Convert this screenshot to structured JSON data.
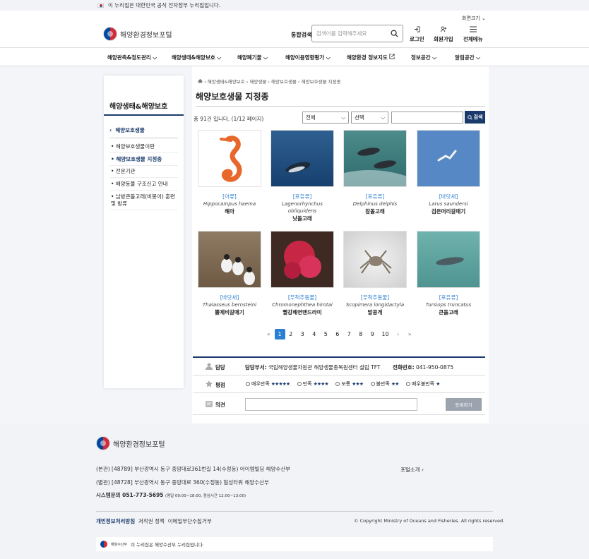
{
  "gov_banner": "이 누리집은 대한민국 공식 전자정부 누리집입니다.",
  "font_size_label": "화면크기",
  "site_name": "해양환경정보포털",
  "search": {
    "label": "통합검색",
    "placeholder": "검색어를 입력해주세요"
  },
  "top_buttons": {
    "login": "로그인",
    "join": "회원가입",
    "menu": "전체메뉴"
  },
  "gnb": [
    "해양관측&정도관리",
    "해양생태&해양보호",
    "해양폐기물",
    "해양이용영향평가",
    "해양환경 정보지도",
    "정보공간",
    "알림공간"
  ],
  "lnb": {
    "title": "해양생태&해양보호",
    "sub": "해양보호생물",
    "items": [
      "해양보호생물이란",
      "해양보호생물 지정종",
      "전문기관",
      "해양동물 구조신고 안내",
      "남방큰돌고래(비봉이) 훈련 및 방류"
    ]
  },
  "breadcrumb": "해양생태&해양보호 › 해양생물 › 해양보호생물 › 해양보호생물 지정종",
  "page_title": "해양보호생물 지정종",
  "total": "총 91건 입니다. (1/12 페이지)",
  "filter1": "전체",
  "filter2": "선택",
  "search_btn": "검색",
  "cards": [
    {
      "cat": "[어류]",
      "sci": "Hippocampus haema",
      "kor": "해마"
    },
    {
      "cat": "[포유류]",
      "sci": "Lagenorhynchus obliquidens",
      "kor": "낫돌고래"
    },
    {
      "cat": "[포유류]",
      "sci": "Delphinus delphis",
      "kor": "참돌고래"
    },
    {
      "cat": "[바닷새]",
      "sci": "Larus saundersi",
      "kor": "검은머리갈매기"
    },
    {
      "cat": "[바닷새]",
      "sci": "Thalasseus bernsteini",
      "kor": "뿔제비갈매기"
    },
    {
      "cat": "[무척추동물]",
      "sci": "Chromonephthea hirotai",
      "kor": "빨강해면맨드라미"
    },
    {
      "cat": "[무척추동물]",
      "sci": "Scopimera longidactyla",
      "kor": "발콩게"
    },
    {
      "cat": "[포유류]",
      "sci": "Tursiops truncatus",
      "kor": "큰돌고래"
    }
  ],
  "pager": {
    "first": "«",
    "prev": "‹",
    "pages": [
      "1",
      "2",
      "3",
      "4",
      "5",
      "6",
      "7",
      "8",
      "9",
      "10"
    ],
    "next": "›",
    "last": "»"
  },
  "info": {
    "manager_label": "담당",
    "dept_label": "담당부서:",
    "dept": "국립해양생물자원관 해양생물종복원센터 설립 TFT",
    "phone_label": "전화번호:",
    "phone": "041-950-0875",
    "rating_label": "평점",
    "ratings": [
      {
        "label": "매우만족",
        "stars": "★★★★★"
      },
      {
        "label": "만족",
        "stars": "★★★★"
      },
      {
        "label": "보통",
        "stars": "★★★"
      },
      {
        "label": "불만족",
        "stars": "★★"
      },
      {
        "label": "매우불만족",
        "stars": "★"
      }
    ],
    "opinion_label": "의견",
    "register_btn": "등록하기"
  },
  "footer": {
    "site_name": "해양환경정보포털",
    "addr1": "(본관) [48789] 부산광역시 동구 중앙대로361번길 14(수정동) 아이엠빌딩 해양수산부",
    "addr2": "(별관) [48728] 부산광역시 동구 중앙대로 360(수정동) 협성타워 해양수산부",
    "phone_label": "시스템문의 051-773-5695",
    "phone_hours": "(평일 09:00~18:00, 점심시간 12:00~13:00)",
    "intro": "포털소개",
    "privacy": "개인정보처리방침",
    "copyright_policy": "저작권 정책",
    "email_policy": "이메일무단수집거부",
    "copyright": "© Copyright Ministry of Oceans and Fisheries. All rights reserved.",
    "bottom_org": "해양수산부",
    "bottom_text": "이 누리집은 해양수산부 누리집입니다."
  }
}
